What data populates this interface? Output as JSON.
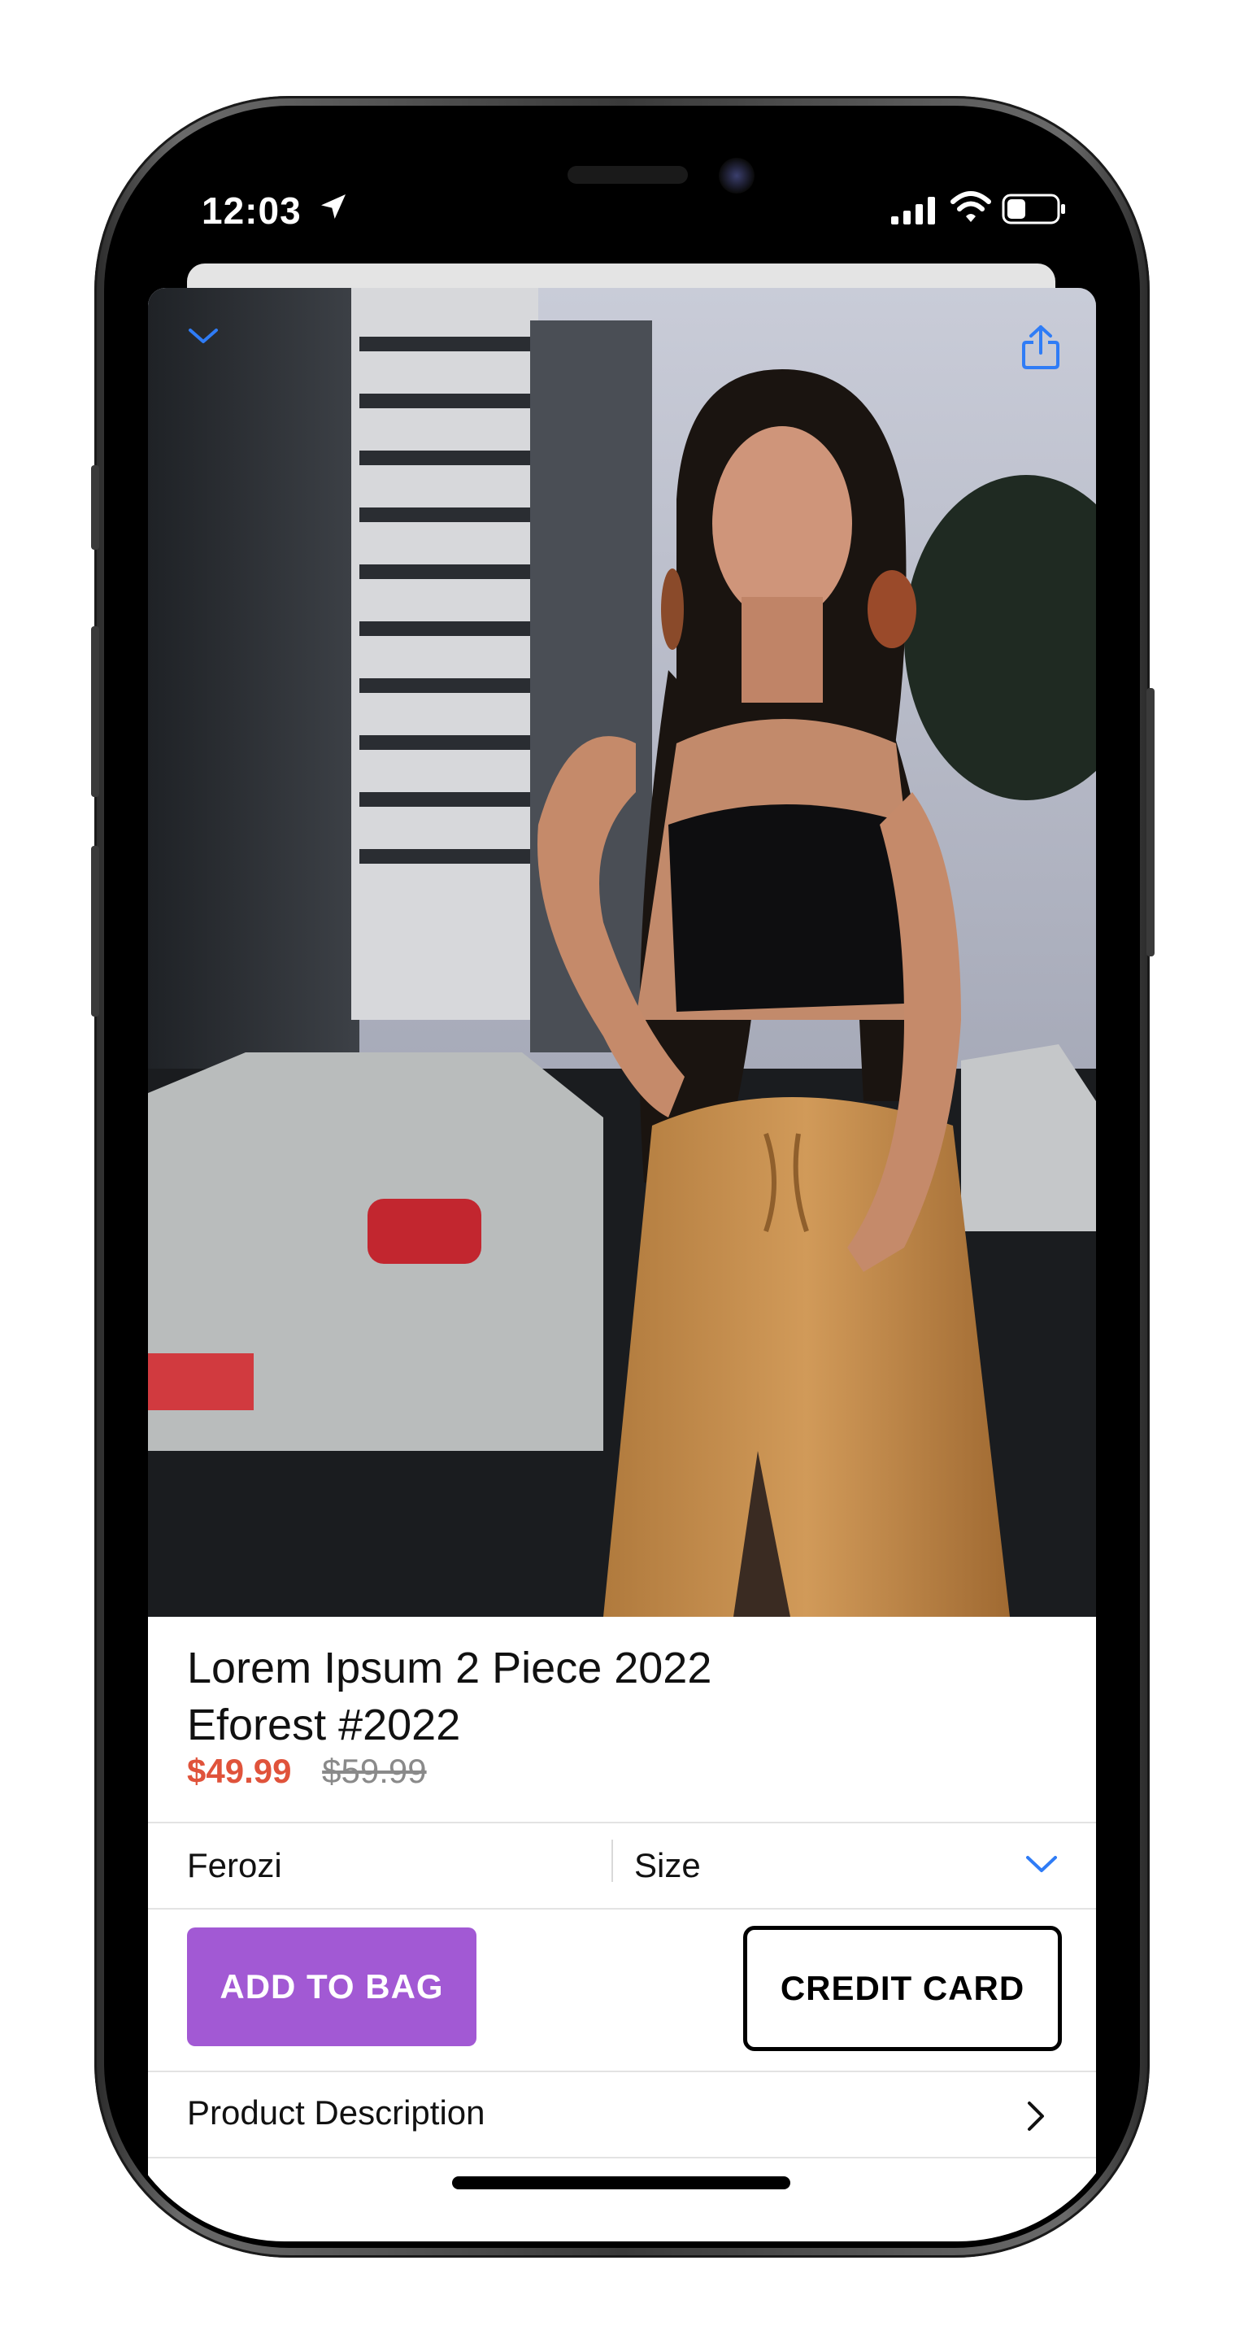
{
  "status_bar": {
    "time": "12:03",
    "location_icon": "location-arrow-icon",
    "signal_icon": "cellular-signal-icon",
    "wifi_icon": "wifi-icon",
    "battery_icon": "battery-icon"
  },
  "nav": {
    "collapse_icon": "chevron-down-icon",
    "share_icon": "share-icon",
    "accent": "#2f7cf6"
  },
  "product": {
    "image_alt": "woman-in-black-crop-top-and-mustard-skirt-photo",
    "title_line1": "Lorem Ipsum 2 Piece 2022",
    "title_line2": "Eforest #2022",
    "price_sale": "$49.99",
    "price_original": "$59.99",
    "sale_color": "#e0533b"
  },
  "options": {
    "color_value": "Ferozi",
    "size_label": "Size",
    "size_chevron_icon": "chevron-down-icon"
  },
  "actions": {
    "add_to_bag": "ADD TO BAG",
    "credit_card": "CREDIT CARD",
    "add_color": "#a259d4"
  },
  "description": {
    "label": "Product Description",
    "chevron_icon": "chevron-right-icon"
  }
}
